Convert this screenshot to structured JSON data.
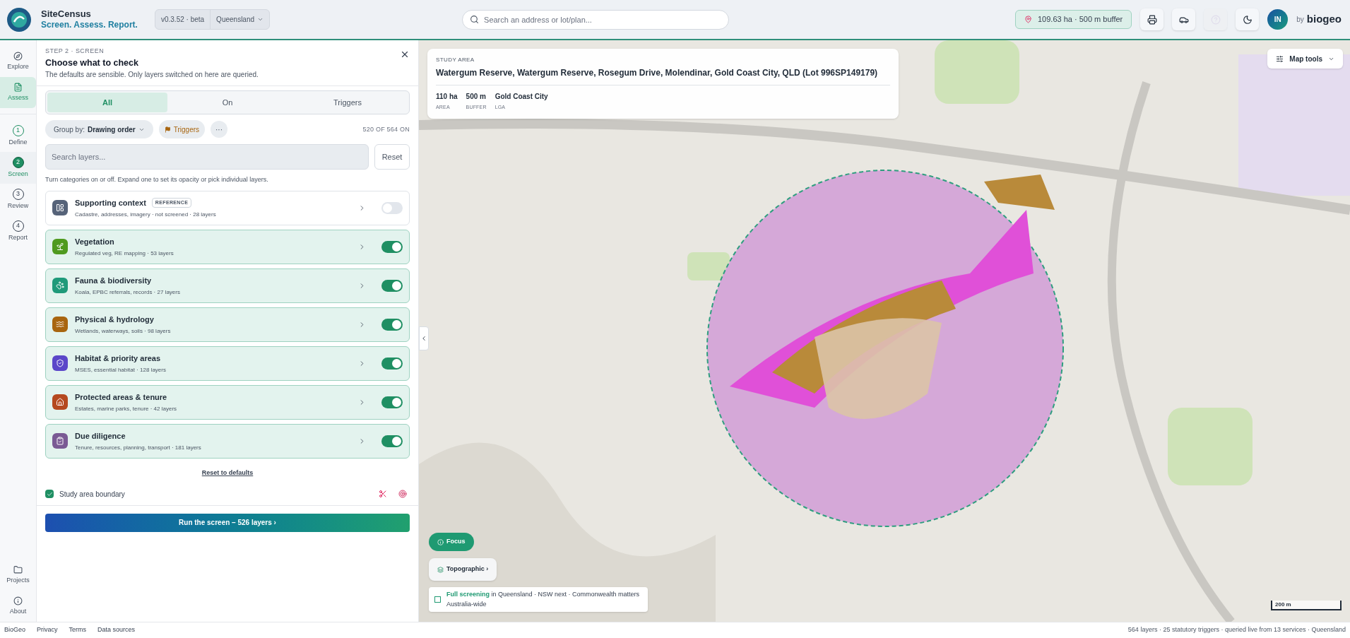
{
  "header": {
    "brand": "SiteCensus",
    "tagline": "Screen. Assess. Report.",
    "version": "v0.3.52 · beta",
    "region": "Queensland",
    "search": {
      "placeholder": "Search an address or lot/plan..."
    },
    "area_badge": "109.63 ha · 500 m buffer",
    "tools": [
      {
        "kind": "print",
        "disabled": false
      },
      {
        "kind": "car",
        "disabled": false
      },
      {
        "kind": "help",
        "disabled": true
      },
      {
        "kind": "theme",
        "disabled": false
      }
    ],
    "avatar": "IN",
    "by": "by",
    "logo": "biogeo"
  },
  "rail": {
    "modes": [
      {
        "label": "Explore",
        "selected": false
      },
      {
        "label": "Assess",
        "selected": true
      }
    ],
    "steps": [
      {
        "number": "1",
        "label": "Define",
        "selected": false,
        "completed": true
      },
      {
        "number": "2",
        "label": "Screen",
        "selected": true,
        "completed": false
      },
      {
        "number": "3",
        "label": "Review",
        "selected": false,
        "completed": false
      },
      {
        "number": "4",
        "label": "Report",
        "selected": false,
        "completed": false
      }
    ],
    "bottom": [
      {
        "label": "Projects"
      },
      {
        "label": "About"
      }
    ]
  },
  "panel": {
    "step_label": "STEP 2 · SCREEN",
    "title": "Choose what to check",
    "subtitle": "The defaults are sensible. Only layers switched on here are queried.",
    "tabs": [
      {
        "label": "All",
        "selected": true
      },
      {
        "label": "On",
        "selected": false
      },
      {
        "label": "Triggers",
        "selected": false
      }
    ],
    "group_by_label": "Group by:",
    "group_by_value": "Drawing order",
    "triggers_chip": "Triggers",
    "more": "···",
    "on_count": "520 OF 564 ON",
    "search": {
      "placeholder": "Search layers..."
    },
    "reset": "Reset",
    "hint": "Turn categories on or off. Expand one to set its opacity or pick individual layers.",
    "categories": [
      {
        "name": "Supporting context",
        "badge": "REFERENCE",
        "description": "Cadastre, addresses, imagery · not screened · 28 layers",
        "on": false,
        "color": "#566379"
      },
      {
        "name": "Vegetation",
        "description": "Regulated veg, RE mapping · 53 layers",
        "on": true,
        "color": "#4f9a1f"
      },
      {
        "name": "Fauna & biodiversity",
        "description": "Koala, EPBC referrals, records · 27 layers",
        "on": true,
        "color": "#1f9a7a"
      },
      {
        "name": "Physical & hydrology",
        "description": "Wetlands, waterways, soils · 98 layers",
        "on": true,
        "color": "#a8650f"
      },
      {
        "name": "Habitat & priority areas",
        "description": "MSES, essential habitat · 128 layers",
        "on": true,
        "color": "#5b47c9"
      },
      {
        "name": "Protected areas & tenure",
        "description": "Estates, marine parks, tenure · 42 layers",
        "on": true,
        "color": "#b5491f"
      },
      {
        "name": "Due diligence",
        "description": "Tenure, resources, planning, transport · 181 layers",
        "on": true,
        "color": "#7a5a94"
      }
    ],
    "reset_defaults": "Reset to defaults",
    "boundary": {
      "label": "Study area boundary",
      "checked": true
    },
    "run": "Run the screen –  526  layers ›"
  },
  "map": {
    "study_area": {
      "heading": "STUDY AREA",
      "address": "Watergum Reserve, Watergum Reserve, Rosegum Drive, Molendinar, Gold Coast City, QLD (Lot 996SP149179)",
      "stats": [
        {
          "value": "110 ha",
          "label": "AREA"
        },
        {
          "value": "500 m",
          "label": "BUFFER"
        },
        {
          "value": "Gold Coast City",
          "label": "LGA"
        }
      ]
    },
    "map_tools": "Map tools",
    "focus": "Focus",
    "basemap": "Topographic ›",
    "coverage": {
      "checked": false,
      "text": "**Full screening** in Queensland  ·  NSW next  ·  Commonwealth matters Australia-wide"
    },
    "scale": "200 m"
  },
  "footer": {
    "links": [
      "BioGeo",
      "Privacy",
      "Terms",
      "Data sources"
    ],
    "status": "564 layers · 25 statutory triggers · queried live from 13 services · Queensland"
  }
}
